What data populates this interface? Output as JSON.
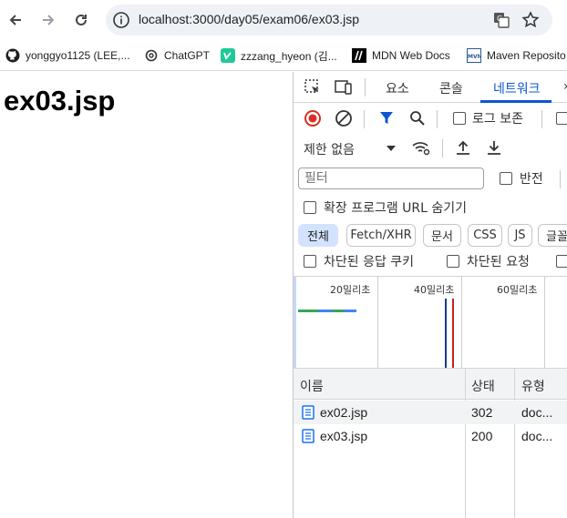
{
  "browser": {
    "url": "localhost:3000/day05/exam06/ex03.jsp",
    "bookmarks": [
      {
        "label": "yonggyo1125 (LEE,...",
        "icon": "github-icon"
      },
      {
        "label": "ChatGPT",
        "icon": "chatgpt-icon"
      },
      {
        "label": "zzzang_hyeon (김...",
        "icon": "velog-icon"
      },
      {
        "label": "MDN Web Docs",
        "icon": "mdn-icon"
      },
      {
        "label": "Maven Reposito",
        "icon": "maven-icon"
      }
    ]
  },
  "page": {
    "heading": "ex03.jsp"
  },
  "devtools": {
    "tabs": [
      {
        "label": "요소"
      },
      {
        "label": "콘솔"
      },
      {
        "label": "네트워크",
        "active": true
      }
    ],
    "preserve_log_label": "로그 보존",
    "throttle_label": "제한 없음",
    "filter_placeholder": "필터",
    "invert_label": "반전",
    "hide_extension_label": "확장 프로그램 URL 숨기기",
    "type_filters": [
      "전체",
      "Fetch/XHR",
      "문서",
      "CSS",
      "JS",
      "글꼴"
    ],
    "blocked_cookies_label": "차단된 응답 쿠키",
    "blocked_requests_label": "차단된 요청",
    "timeline_ticks": [
      "20밀리초",
      "40밀리초",
      "60밀리초"
    ],
    "table": {
      "headers": [
        "이름",
        "상태",
        "유형"
      ],
      "rows": [
        {
          "name": "ex02.jsp",
          "status": "302",
          "type": "doc..."
        },
        {
          "name": "ex03.jsp",
          "status": "200",
          "type": "doc..."
        }
      ]
    },
    "colors": {
      "accent": "#0b57d0",
      "record_red": "#d93025"
    }
  }
}
